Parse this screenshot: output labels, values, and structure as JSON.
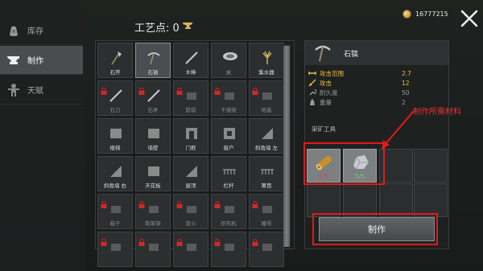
{
  "sidebar": {
    "items": [
      {
        "label": "库存",
        "icon": "bag-icon"
      },
      {
        "label": "制作",
        "icon": "anvil-icon"
      },
      {
        "label": "天赋",
        "icon": "figure-icon"
      }
    ]
  },
  "header": {
    "craft_points_label": "工艺点: 0",
    "coins": "16777215"
  },
  "grid": {
    "items": [
      {
        "label": "石斧",
        "locked": false,
        "icon": "stone-axe-icon"
      },
      {
        "label": "石镐",
        "locked": false,
        "icon": "stone-pickaxe-icon",
        "selected": true
      },
      {
        "label": "木棒",
        "locked": false,
        "icon": "wood-stick-icon"
      },
      {
        "label": "火",
        "locked": false,
        "icon": "campfire-icon"
      },
      {
        "label": "集水器",
        "locked": false,
        "icon": "water-collector-icon"
      },
      {
        "label": "石刀",
        "locked": true,
        "icon": "stone-knife-icon"
      },
      {
        "label": "石矛",
        "locked": true,
        "icon": "stone-spear-icon"
      },
      {
        "label": "箭袋",
        "locked": true,
        "icon": "quiver-icon"
      },
      {
        "label": "干燥架",
        "locked": true,
        "icon": "drying-rack-icon"
      },
      {
        "label": "地基",
        "locked": true,
        "icon": "foundation-icon"
      },
      {
        "label": "楼梯",
        "locked": false,
        "icon": "stairs-icon"
      },
      {
        "label": "墙壁",
        "locked": false,
        "icon": "wall-icon"
      },
      {
        "label": "门框",
        "locked": false,
        "icon": "doorframe-icon"
      },
      {
        "label": "窗户",
        "locked": false,
        "icon": "window-icon"
      },
      {
        "label": "斜角墙 左",
        "locked": false,
        "icon": "slope-wall-left-icon"
      },
      {
        "label": "斜角墙 右",
        "locked": false,
        "icon": "slope-wall-right-icon"
      },
      {
        "label": "天花板",
        "locked": false,
        "icon": "ceiling-icon"
      },
      {
        "label": "屋顶",
        "locked": false,
        "icon": "roof-icon"
      },
      {
        "label": "栏杆",
        "locked": false,
        "icon": "railing-icon"
      },
      {
        "label": "篱笆",
        "locked": false,
        "icon": "fence-icon"
      },
      {
        "label": "箱子",
        "locked": true,
        "icon": "chest-icon"
      },
      {
        "label": "制革架",
        "locked": true,
        "icon": "tanning-rack-icon"
      },
      {
        "label": "营火",
        "locked": true,
        "icon": "bonfire-icon"
      },
      {
        "label": "织布机",
        "locked": true,
        "icon": "loom-icon"
      },
      {
        "label": "睡带",
        "locked": true,
        "icon": "sleeping-bag-icon"
      },
      {
        "label": "",
        "locked": true,
        "icon": "item-icon"
      },
      {
        "label": "",
        "locked": true,
        "icon": "item-icon"
      },
      {
        "label": "",
        "locked": true,
        "icon": "item-icon"
      },
      {
        "label": "",
        "locked": true,
        "icon": "item-icon"
      },
      {
        "label": "",
        "locked": true,
        "icon": "item-icon"
      }
    ]
  },
  "detail": {
    "title": "石镐",
    "stats": [
      {
        "name": "攻击范围",
        "value": "2.7",
        "color": "#e8c040",
        "icon": "range-icon"
      },
      {
        "name": "攻击",
        "value": "12",
        "color": "#e8c040",
        "icon": "sword-icon"
      },
      {
        "name": "耐久度",
        "value": "50",
        "color": "#9a9a9a",
        "icon": "wrench-icon"
      },
      {
        "name": "重量",
        "value": "2",
        "color": "#9a9a9a",
        "icon": "weight-icon"
      }
    ],
    "tool_type": "采矿工具",
    "materials": [
      {
        "count": "0/5",
        "color": "#e04040",
        "icon": "wood-log-icon"
      },
      {
        "count": "5/5",
        "color": "#60d060",
        "icon": "stone-icon"
      }
    ],
    "craft_button": "制作"
  },
  "annotation": "制作所需材料",
  "colors": {
    "annotation_red": "#e01a1a",
    "highlight_gold": "#e8c040",
    "ok_green": "#60d060",
    "missing_red": "#e04040"
  }
}
